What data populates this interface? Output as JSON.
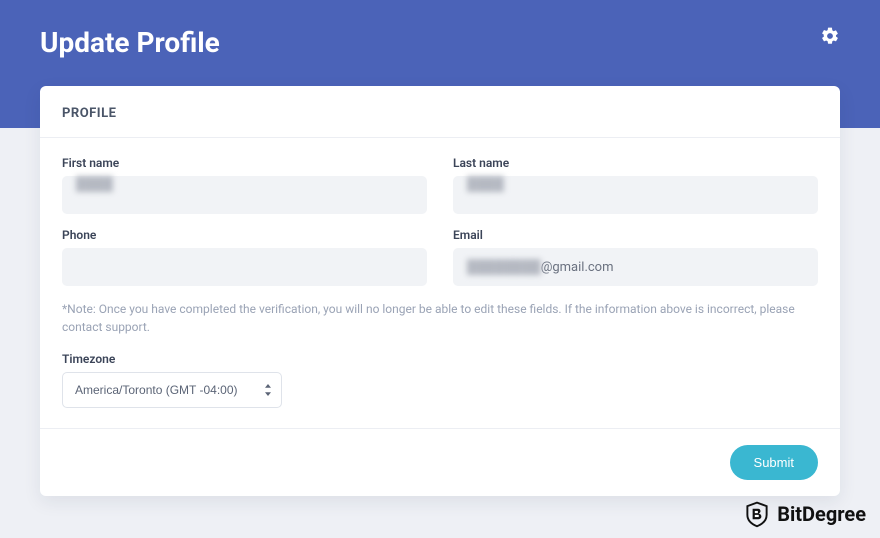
{
  "header": {
    "title": "Update Profile"
  },
  "card": {
    "section_title": "PROFILE",
    "fields": {
      "first_name": {
        "label": "First name",
        "value": "████"
      },
      "last_name": {
        "label": "Last name",
        "value": "████"
      },
      "phone": {
        "label": "Phone",
        "value": ""
      },
      "email": {
        "label": "Email",
        "value_prefix": "████████",
        "value_suffix": "@gmail.com"
      }
    },
    "note": "*Note: Once you have completed the verification, you will no longer be able to edit these fields. If the information above is incorrect, please contact support.",
    "timezone": {
      "label": "Timezone",
      "selected": "America/Toronto (GMT -04:00)"
    },
    "submit_label": "Submit"
  },
  "watermark": {
    "text": "BitDegree"
  }
}
